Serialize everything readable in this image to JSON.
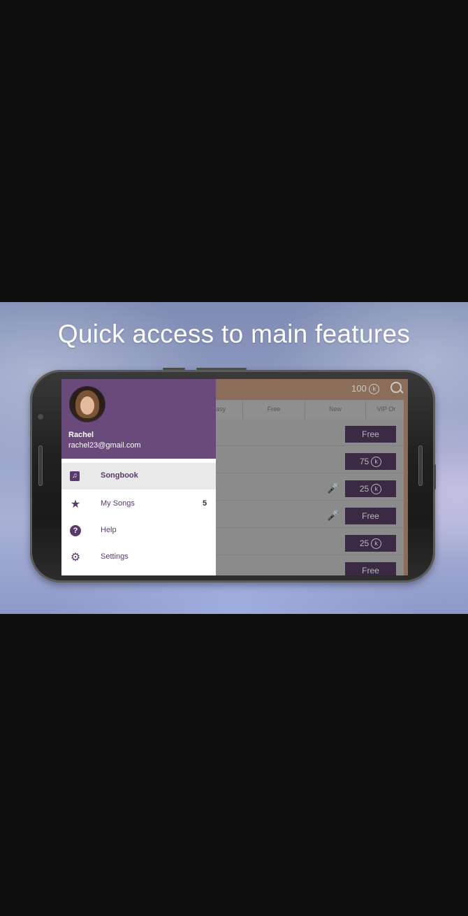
{
  "banner": {
    "headline": "Quick access to main features"
  },
  "app": {
    "coins": "100",
    "coin_symbol": "ⓚ",
    "tabs": [
      "asy",
      "Free",
      "New",
      "VIP Or"
    ],
    "rows": [
      {
        "price": "Free",
        "coin": false,
        "mic": false
      },
      {
        "price": "75",
        "coin": true,
        "mic": false
      },
      {
        "price": "25",
        "coin": true,
        "mic": true
      },
      {
        "price": "Free",
        "coin": false,
        "mic": true
      },
      {
        "price": "25",
        "coin": true,
        "mic": false
      },
      {
        "price": "Free",
        "coin": false,
        "mic": false
      }
    ]
  },
  "drawer": {
    "user_name": "Rachel",
    "user_email": "rachel23@gmail.com",
    "items": [
      {
        "label": "Songbook",
        "icon": "music-note-icon",
        "active": true
      },
      {
        "label": "My Songs",
        "icon": "star-icon",
        "count": "5"
      },
      {
        "label": "Help",
        "icon": "help-icon"
      },
      {
        "label": "Settings",
        "icon": "gear-icon"
      }
    ]
  },
  "colors": {
    "drawer_header": "#6a4a7b",
    "accent": "#5a3a6a",
    "price_button": "#3a2a44"
  }
}
